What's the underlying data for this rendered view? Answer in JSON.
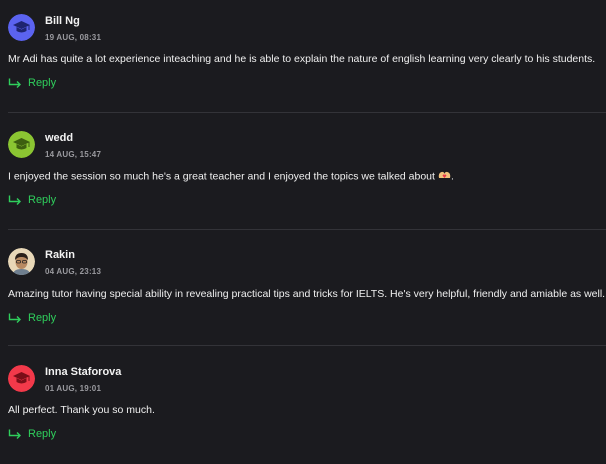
{
  "comments": [
    {
      "author": "Bill Ng",
      "date": "19 AUG, 08:31",
      "text": "Mr Adi has quite a lot experience inteaching and he is able to explain the nature of english learning very clearly to his students.",
      "reply_label": "Reply",
      "avatar": {
        "type": "icon",
        "icon": "graduation-cap-icon",
        "color": "#5b63f0"
      }
    },
    {
      "author": "wedd",
      "date": "14 AUG, 15:47",
      "text": "I enjoyed the session so much he's a great teacher and I enjoyed the topics we talked about",
      "text_suffix": ".",
      "emoji": "hands-heart-emoji",
      "reply_label": "Reply",
      "avatar": {
        "type": "icon",
        "icon": "graduation-cap-icon",
        "color": "#8bc532"
      }
    },
    {
      "author": "Rakin",
      "date": "04 AUG, 23:13",
      "text": "Amazing tutor having special ability in revealing practical tips and tricks for IELTS. He's very helpful, friendly and amiable as well.",
      "reply_label": "Reply",
      "avatar": {
        "type": "photo",
        "icon": "user-photo",
        "color": "#e8d8b8"
      }
    },
    {
      "author": "Inna Staforova",
      "date": "01 AUG, 19:01",
      "text": "All perfect. Thank you so much.",
      "reply_label": "Reply",
      "avatar": {
        "type": "icon",
        "icon": "graduation-cap-icon",
        "color": "#f2394a"
      }
    }
  ],
  "colors": {
    "background": "#1b1b1f",
    "reply": "#2fcf5c",
    "divider": "#333338",
    "date": "#9a9a9f"
  }
}
